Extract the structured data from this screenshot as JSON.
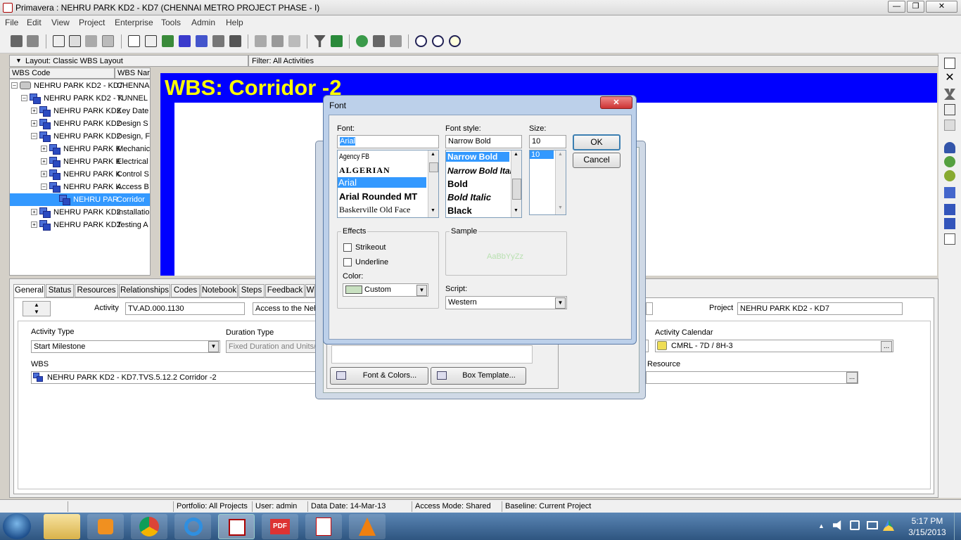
{
  "window": {
    "title": "Primavera : NEHRU PARK KD2 - KD7 (CHENNAI METRO PROJECT PHASE - I)"
  },
  "menu": [
    "File",
    "Edit",
    "View",
    "Project",
    "Enterprise",
    "Tools",
    "Admin",
    "Help"
  ],
  "layout": {
    "label": "Layout: Classic WBS Layout",
    "filter": "Filter: All Activities"
  },
  "tree": {
    "col_code": "WBS Code",
    "col_name": "WBS Nar",
    "rows": [
      {
        "code": "NEHRU PARK KD2 - KD7",
        "name": "CHENNA"
      },
      {
        "code": "NEHRU PARK KD2 - K",
        "name": "TUNNEL"
      },
      {
        "code": "NEHRU PARK KD2",
        "name": "Key Date"
      },
      {
        "code": "NEHRU PARK KD2",
        "name": "Design S"
      },
      {
        "code": "NEHRU PARK KD2",
        "name": "Design, F"
      },
      {
        "code": "NEHRU PARK K",
        "name": "Mechanic"
      },
      {
        "code": "NEHRU PARK K",
        "name": "Electrical"
      },
      {
        "code": "NEHRU PARK K",
        "name": "Control S"
      },
      {
        "code": "NEHRU PARK K",
        "name": "Access B"
      },
      {
        "code": "NEHRU PAR",
        "name": "Corridor"
      },
      {
        "code": "NEHRU PARK KD2",
        "name": "Installatio"
      },
      {
        "code": "NEHRU PARK KD2",
        "name": "Testing A"
      }
    ]
  },
  "wbs_panel": {
    "title": "WBS: Corridor -2"
  },
  "tabs": [
    "General",
    "Status",
    "Resources",
    "Relationships",
    "Codes",
    "Notebook",
    "Steps",
    "Feedback",
    "W"
  ],
  "details": {
    "activity_label": "Activity",
    "activity_id": "TV.AD.000.1130",
    "activity_name": "Access to the Nehru",
    "project_label": "Project",
    "project_value": "NEHRU PARK KD2 - KD7",
    "activity_type_label": "Activity Type",
    "activity_type_value": "Start Milestone",
    "duration_type_label": "Duration Type",
    "duration_type_value": "Fixed Duration and Units/Time",
    "activity_calendar_label": "Activity Calendar",
    "activity_calendar_value": "CMRL - 7D / 8H-3",
    "wbs_label": "WBS",
    "wbs_value": "NEHRU PARK KD2 - KD7.TVS.5.12.2  Corridor -2",
    "resource_label": "Resource"
  },
  "bg_dialog": {
    "font_colors_btn": "Font & Colors...",
    "box_template_btn": "Box Template..."
  },
  "font_dialog": {
    "title": "Font",
    "font_label": "Font:",
    "font_value": "Arial",
    "fonts": [
      "Agency FB",
      "ALGERIAN",
      "Arial",
      "Arial Rounded MT",
      "Baskerville Old Face"
    ],
    "style_label": "Font style:",
    "style_value": "Narrow Bold",
    "styles": [
      "Narrow Bold",
      "Narrow Bold Italic",
      "Bold",
      "Bold Italic",
      "Black"
    ],
    "size_label": "Size:",
    "size_value": "10",
    "sizes": [
      "10"
    ],
    "ok": "OK",
    "cancel": "Cancel",
    "effects_label": "Effects",
    "strikeout": "Strikeout",
    "underline": "Underline",
    "color_label": "Color:",
    "color_value": "Custom",
    "sample_label": "Sample",
    "sample_text": "AaBbYyZz",
    "script_label": "Script:",
    "script_value": "Western"
  },
  "status": {
    "portfolio": "Portfolio: All Projects",
    "user": "User: admin",
    "data_date": "Data Date: 14-Mar-13",
    "access": "Access Mode: Shared",
    "baseline": "Baseline: Current Project"
  },
  "clock": {
    "time": "5:17 PM",
    "date": "3/15/2013"
  },
  "colors": {
    "wbs_bg": "#0000ff",
    "wbs_text": "#ffff00",
    "selection": "#3399ff",
    "sample_text": "#b8e0b0"
  }
}
